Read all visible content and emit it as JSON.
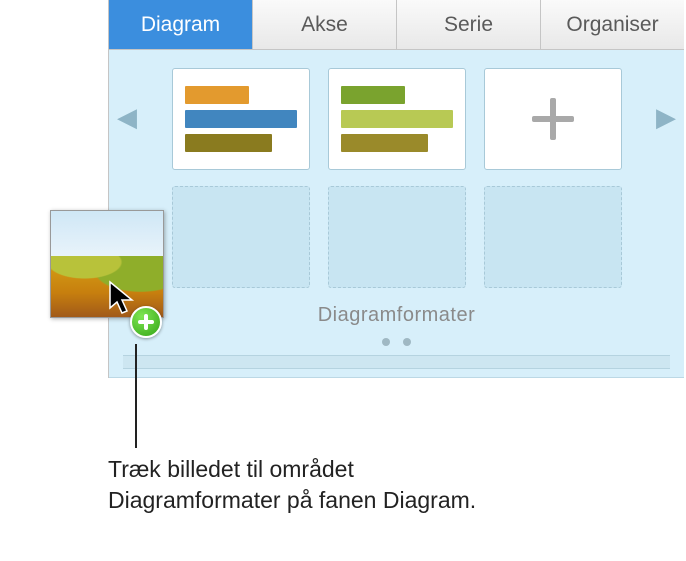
{
  "tabs": [
    {
      "label": "Diagram",
      "active": true
    },
    {
      "label": "Akse",
      "active": false
    },
    {
      "label": "Serie",
      "active": false
    },
    {
      "label": "Organiser",
      "active": false
    }
  ],
  "section_title": "Diagramformater",
  "caption_line1": "Træk billedet til området",
  "caption_line2": "Diagramformater på fanen Diagram.",
  "icons": {
    "nav_left": "◀",
    "nav_right": "▶"
  }
}
